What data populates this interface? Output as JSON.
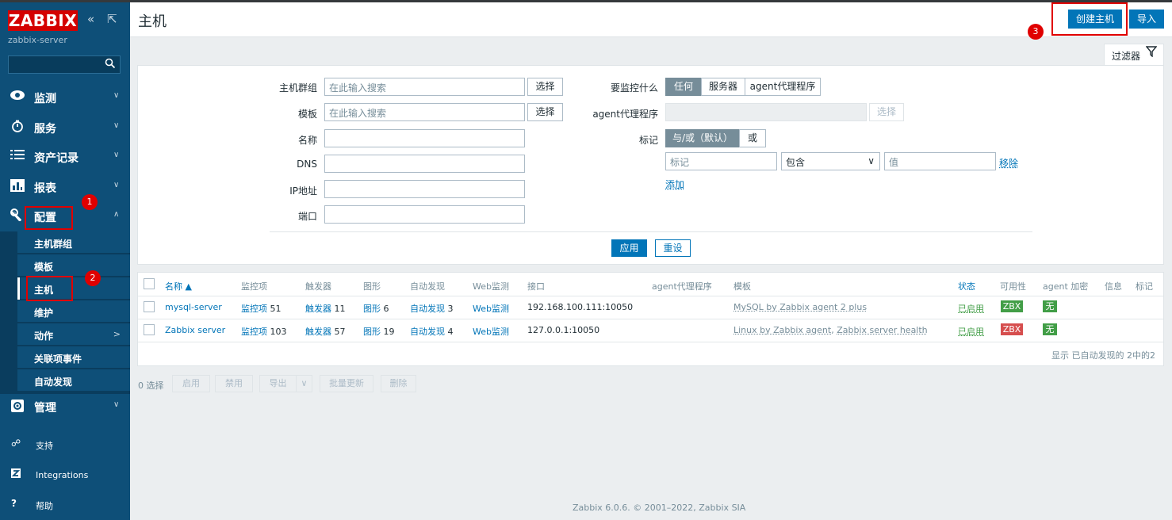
{
  "sidebar": {
    "logo": "ZABBIX",
    "server_name": "zabbix-server",
    "collapse_icon": "«",
    "kiosk_icon": "⇱",
    "menu": [
      {
        "label": "监测",
        "icon": "eye-icon"
      },
      {
        "label": "服务",
        "icon": "clock-icon"
      },
      {
        "label": "资产记录",
        "icon": "list-icon"
      },
      {
        "label": "报表",
        "icon": "chart-icon"
      },
      {
        "label": "配置",
        "icon": "wrench-icon"
      },
      {
        "label": "管理",
        "icon": "gear-icon"
      }
    ],
    "submenu": [
      "主机群组",
      "模板",
      "主机",
      "维护",
      "动作",
      "关联项事件",
      "自动发现"
    ],
    "footer": [
      {
        "label": "支持",
        "icon": "headset-icon"
      },
      {
        "label": "Integrations",
        "icon": "z-icon"
      },
      {
        "label": "帮助",
        "icon": "question-icon"
      }
    ]
  },
  "annotations": [
    "1",
    "2",
    "3"
  ],
  "header": {
    "title": "主机",
    "create_host": "创建主机",
    "import": "导入"
  },
  "filter": {
    "tab_label": "过滤器",
    "host_groups_label": "主机群组",
    "host_groups_placeholder": "在此输入搜索",
    "templates_label": "模板",
    "templates_placeholder": "在此输入搜索",
    "select_btn": "选择",
    "name_label": "名称",
    "dns_label": "DNS",
    "ip_label": "IP地址",
    "port_label": "端口",
    "monitored_by_label": "要监控什么",
    "monitored_by_options": [
      "任何",
      "服务器",
      "agent代理程序"
    ],
    "proxy_label": "agent代理程序",
    "tags_label": "标记",
    "tags_options": [
      "与/或（默认）",
      "或"
    ],
    "tag_placeholder": "标记",
    "tag_operator": "包含",
    "tag_value_placeholder": "值",
    "remove_link": "移除",
    "add_link": "添加",
    "apply_btn": "应用",
    "reset_btn": "重设"
  },
  "table": {
    "headers": [
      "名称 ▲",
      "监控项",
      "触发器",
      "图形",
      "自动发现",
      "Web监测",
      "接口",
      "agent代理程序",
      "模板",
      "状态",
      "可用性",
      "agent 加密",
      "信息",
      "标记"
    ],
    "rows": [
      {
        "name": "mysql-server",
        "items": "监控项",
        "items_count": "51",
        "triggers": "触发器",
        "triggers_count": "11",
        "graphs": "图形",
        "graphs_count": "6",
        "discovery": "自动发现",
        "discovery_count": "3",
        "web": "Web监测",
        "interface": "192.168.100.111:10050",
        "templates": [
          "MySQL by Zabbix agent 2 plus"
        ],
        "status": "已启用",
        "availability": "ZBX",
        "availability_color": "#429e47",
        "encryption": "无"
      },
      {
        "name": "Zabbix server",
        "items": "监控项",
        "items_count": "103",
        "triggers": "触发器",
        "triggers_count": "57",
        "graphs": "图形",
        "graphs_count": "19",
        "discovery": "自动发现",
        "discovery_count": "4",
        "web": "Web监测",
        "interface": "127.0.0.1:10050",
        "templates": [
          "Linux by Zabbix agent",
          "Zabbix server health"
        ],
        "template_sep": ",",
        "status": "已启用",
        "availability": "ZBX",
        "availability_color": "#d64e4e",
        "encryption": "无"
      }
    ],
    "paging": "显示 已自动发现的 2中的2"
  },
  "mass_actions": {
    "selected": "0 选择",
    "enable": "启用",
    "disable": "禁用",
    "export": "导出",
    "mass_update": "批量更新",
    "delete": "删除"
  },
  "footer": "Zabbix 6.0.6. © 2001–2022, Zabbix SIA",
  "colors": {
    "brand": "#d40000",
    "sidebar": "#0e4f78",
    "accent": "#0275b8",
    "enabled": "#429e47"
  }
}
